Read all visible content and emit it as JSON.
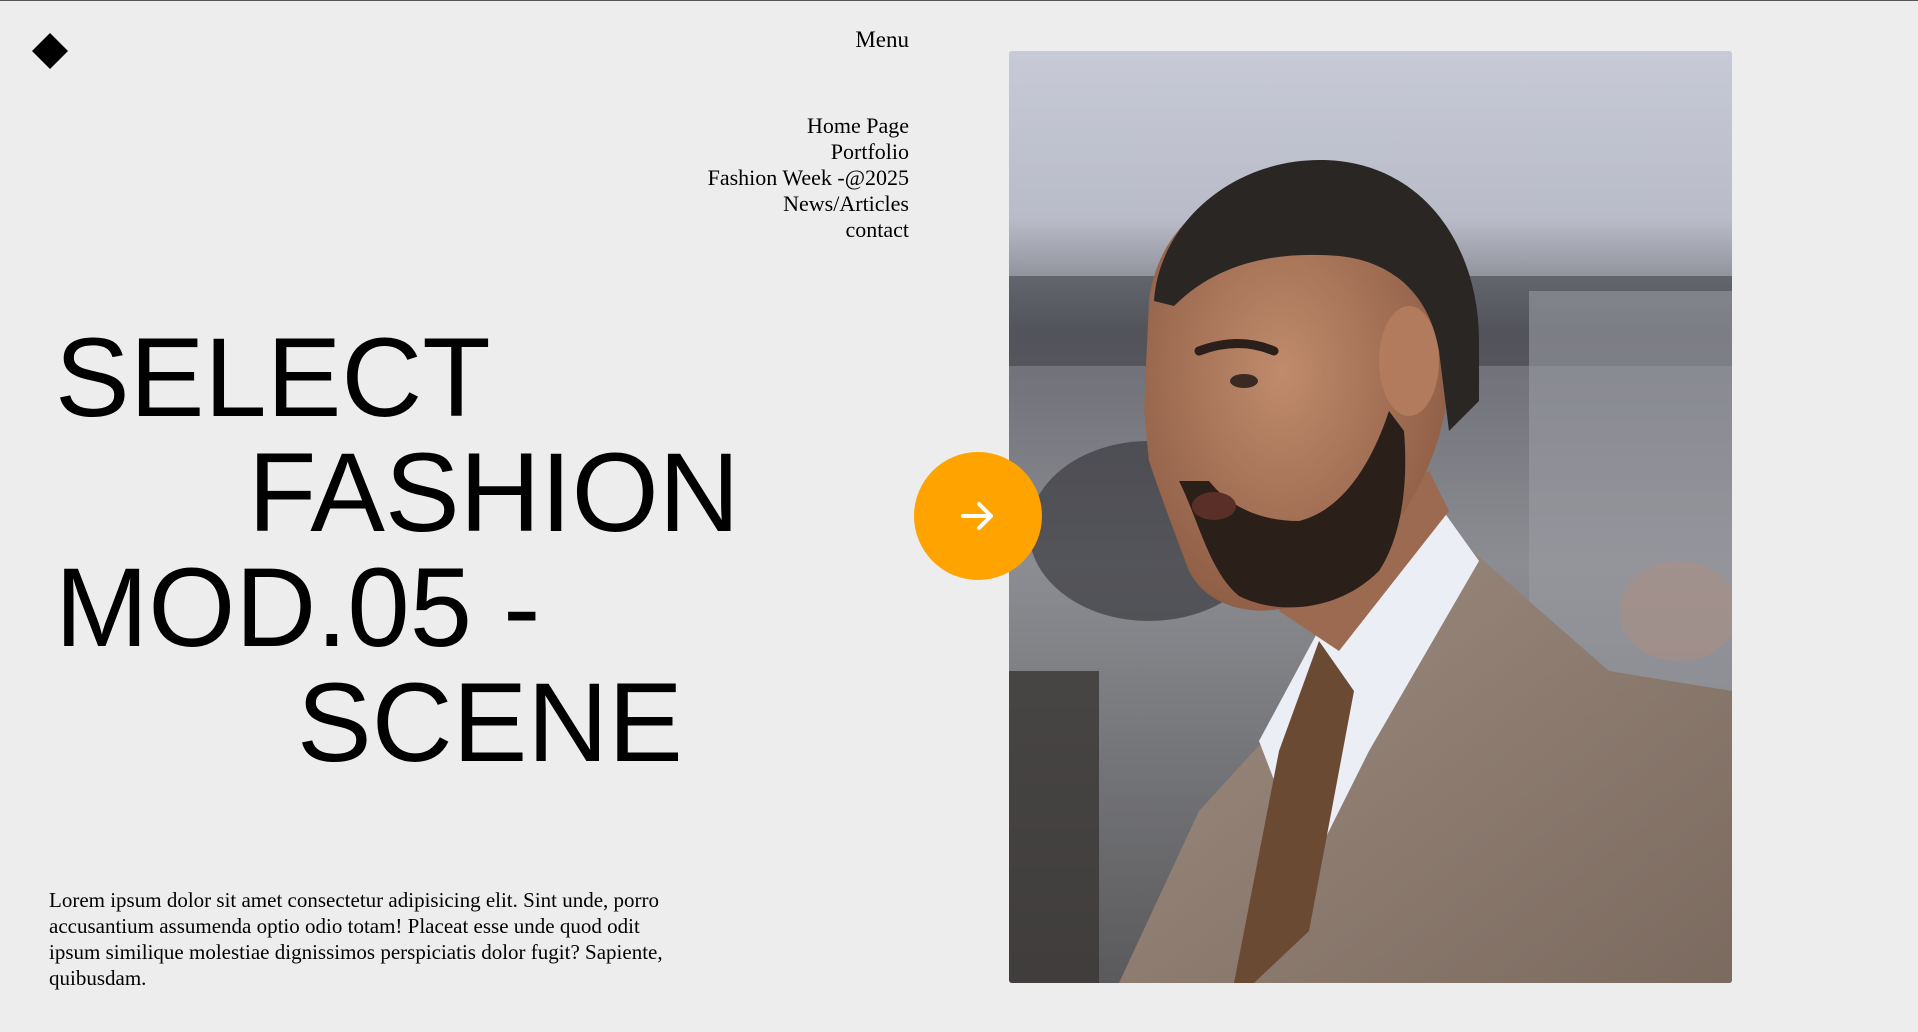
{
  "header": {
    "menu_label": "Menu"
  },
  "nav": {
    "items": [
      {
        "label": "Home Page"
      },
      {
        "label": "Portfolio"
      },
      {
        "label": "Fashion Week -@2025"
      },
      {
        "label": "News/Articles"
      },
      {
        "label": "contact"
      }
    ]
  },
  "hero": {
    "headline_lines": [
      "SELECT",
      "FASHION",
      "MOD.05 -",
      "SCENE"
    ],
    "description": "Lorem ipsum dolor sit amet consectetur adipisicing elit. Sint unde, porro accusantium assumenda optio odio totam! Placeat esse unde quod odit ipsum similique molestiae dignissimos perspiciatis dolor fugit? Sapiente, quibusdam.",
    "next_button_icon": "arrow-right-icon",
    "accent_color": "#ffa300"
  },
  "icons": {
    "logo": "diamond-logo-icon"
  },
  "colors": {
    "background": "#ededed",
    "text": "#000000",
    "accent": "#ffa300"
  }
}
